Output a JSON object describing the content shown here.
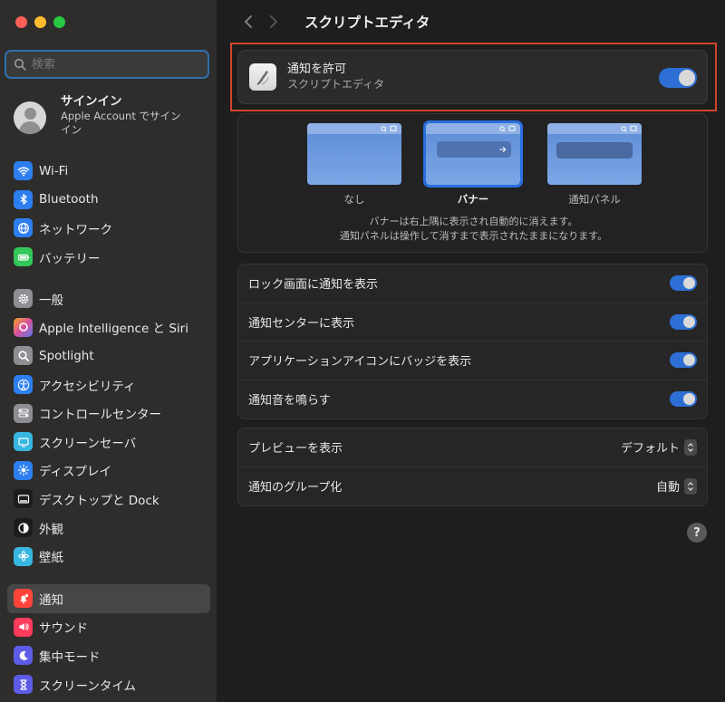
{
  "sidebar": {
    "search_placeholder": "検索",
    "account": {
      "title": "サインイン",
      "subtitle": "Apple Account でサインイン"
    },
    "items": [
      {
        "label": "Wi-Fi",
        "icon": "wifi-icon",
        "color": "#2d7ff0"
      },
      {
        "label": "Bluetooth",
        "icon": "bluetooth-icon",
        "color": "#2d7ff0"
      },
      {
        "label": "ネットワーク",
        "icon": "globe-icon",
        "color": "#2d7ff0"
      },
      {
        "label": "バッテリー",
        "icon": "battery-icon",
        "color": "#34c759"
      },
      {
        "label": "一般",
        "icon": "gear-icon",
        "color": "#8e8e93"
      },
      {
        "label": "Apple Intelligence と Siri",
        "icon": "siri-icon",
        "color": "#c86dd7"
      },
      {
        "label": "Spotlight",
        "icon": "magnifier-icon",
        "color": "#8e8e93"
      },
      {
        "label": "アクセシビリティ",
        "icon": "accessibility-icon",
        "color": "#2d7ff0"
      },
      {
        "label": "コントロールセンター",
        "icon": "control-center-icon",
        "color": "#8e8e93"
      },
      {
        "label": "スクリーンセーバ",
        "icon": "screensaver-icon",
        "color": "#37b6e0"
      },
      {
        "label": "ディスプレイ",
        "icon": "sun-icon",
        "color": "#2d7ff0"
      },
      {
        "label": "デスクトップと Dock",
        "icon": "dock-icon",
        "color": "#1c1c1e"
      },
      {
        "label": "外観",
        "icon": "appearance-icon",
        "color": "#1c1c1e"
      },
      {
        "label": "壁紙",
        "icon": "wallpaper-icon",
        "color": "#37b6e0"
      },
      {
        "label": "通知",
        "icon": "bell-icon",
        "color": "#ff453a"
      },
      {
        "label": "サウンド",
        "icon": "speaker-icon",
        "color": "#ff3b5c"
      },
      {
        "label": "集中モード",
        "icon": "moon-icon",
        "color": "#5e5ce6"
      },
      {
        "label": "スクリーンタイム",
        "icon": "hourglass-icon",
        "color": "#5e5ce6"
      }
    ]
  },
  "header": {
    "title": "スクリプトエディタ"
  },
  "allow": {
    "title": "通知を許可",
    "subtitle": "スクリプトエディタ",
    "enabled": true
  },
  "alert_style": {
    "options": [
      {
        "label": "なし"
      },
      {
        "label": "バナー"
      },
      {
        "label": "通知パネル"
      }
    ],
    "selected": "バナー",
    "description_line1": "バナーは右上隅に表示され自動的に消えます。",
    "description_line2": "通知パネルは操作して消すまで表示されたままになります。"
  },
  "toggles": [
    {
      "label": "ロック画面に通知を表示",
      "on": true
    },
    {
      "label": "通知センターに表示",
      "on": true
    },
    {
      "label": "アプリケーションアイコンにバッジを表示",
      "on": true
    },
    {
      "label": "通知音を鳴らす",
      "on": true
    }
  ],
  "selects": [
    {
      "label": "プレビューを表示",
      "value": "デフォルト"
    },
    {
      "label": "通知のグループ化",
      "value": "自動"
    }
  ],
  "help": {
    "label": "?"
  }
}
